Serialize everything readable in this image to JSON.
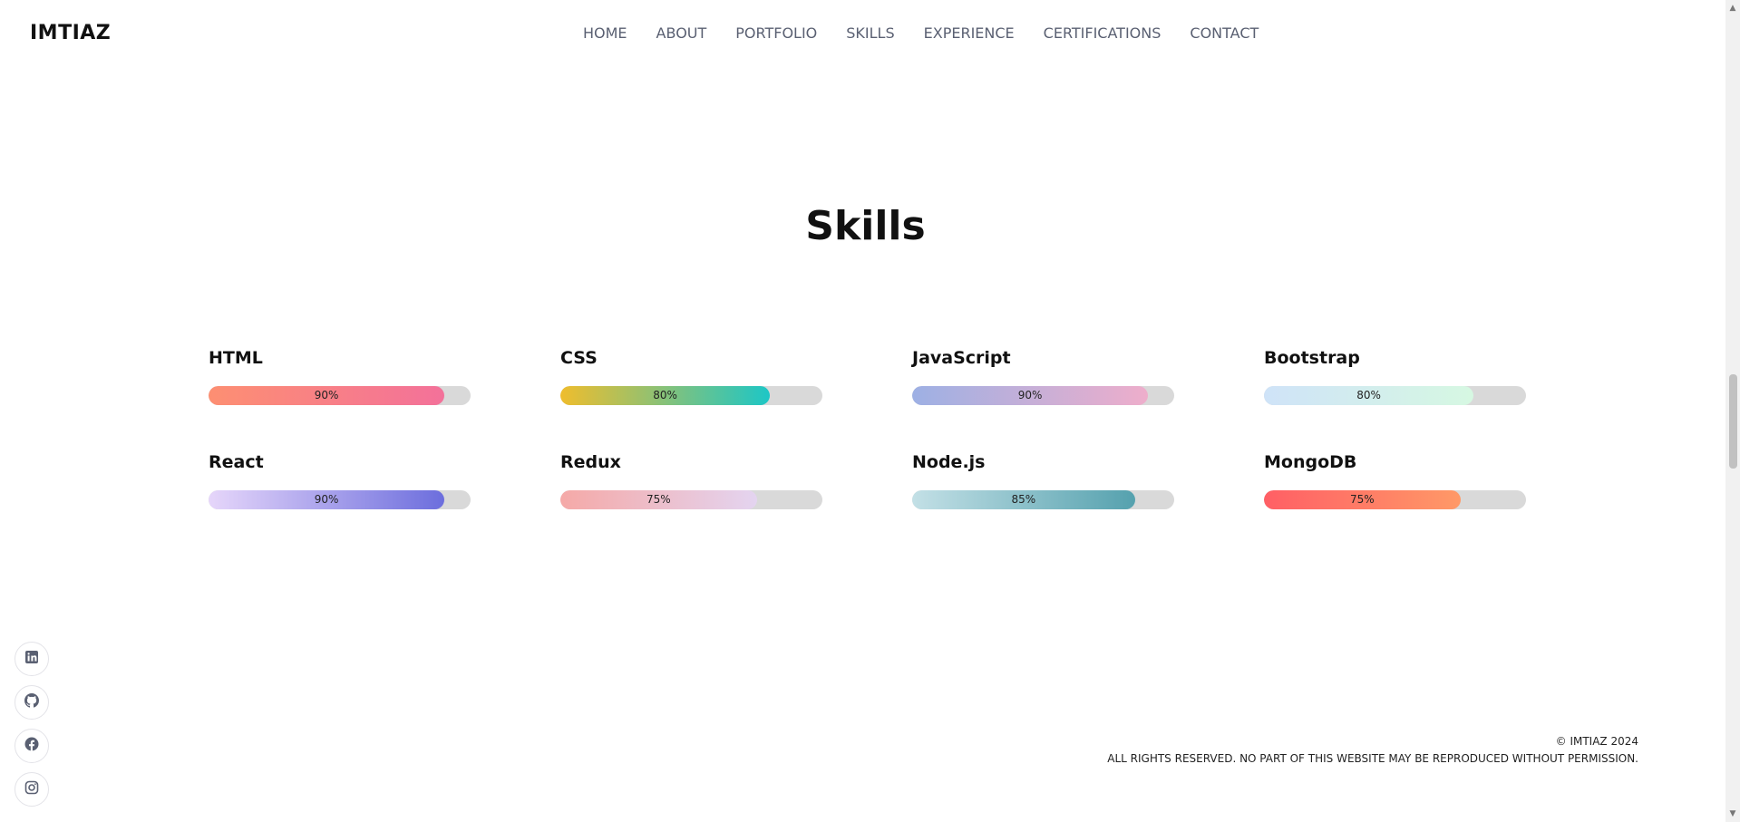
{
  "header": {
    "logo": "IMTIAZ",
    "nav": [
      {
        "label": "HOME"
      },
      {
        "label": "ABOUT"
      },
      {
        "label": "PORTFOLIO"
      },
      {
        "label": "SKILLS"
      },
      {
        "label": "EXPERIENCE"
      },
      {
        "label": "CERTIFICATIONS"
      },
      {
        "label": "CONTACT"
      }
    ]
  },
  "skills_section": {
    "title": "Skills",
    "skills": [
      {
        "name": "HTML",
        "label": "90%",
        "level": 0.9,
        "colors": [
          "#fd8f72",
          "#f3719a"
        ]
      },
      {
        "name": "CSS",
        "label": "80%",
        "level": 0.8,
        "colors": [
          "#efbd2d",
          "#1dc6c6"
        ]
      },
      {
        "name": "JavaScript",
        "label": "90%",
        "level": 0.9,
        "colors": [
          "#9db0e4",
          "#eeaecb"
        ]
      },
      {
        "name": "Bootstrap",
        "label": "80%",
        "level": 0.8,
        "colors": [
          "#cfe3f8",
          "#d6f8e2"
        ]
      },
      {
        "name": "React",
        "label": "90%",
        "level": 0.9,
        "colors": [
          "#e6d6fa",
          "#6c6edd"
        ]
      },
      {
        "name": "Redux",
        "label": "75%",
        "level": 0.75,
        "colors": [
          "#f5a9a7",
          "#e4d4f0"
        ]
      },
      {
        "name": "Node.js",
        "label": "85%",
        "level": 0.85,
        "colors": [
          "#c3e0e6",
          "#55a1ae"
        ]
      },
      {
        "name": "MongoDB",
        "label": "75%",
        "level": 0.75,
        "colors": [
          "#ff5f65",
          "#ff9967"
        ]
      }
    ]
  },
  "social": [
    {
      "icon": "linkedin-icon"
    },
    {
      "icon": "github-icon"
    },
    {
      "icon": "facebook-icon"
    },
    {
      "icon": "instagram-icon"
    }
  ],
  "footer": {
    "copyright": "© IMTIAZ 2024",
    "rights": "ALL RIGHTS RESERVED. NO PART OF THIS WEBSITE MAY BE REPRODUCED WITHOUT PERMISSION."
  },
  "colors": {
    "text": "#111111",
    "nav_text": "#5a6072",
    "track": "#d9d9d9"
  }
}
